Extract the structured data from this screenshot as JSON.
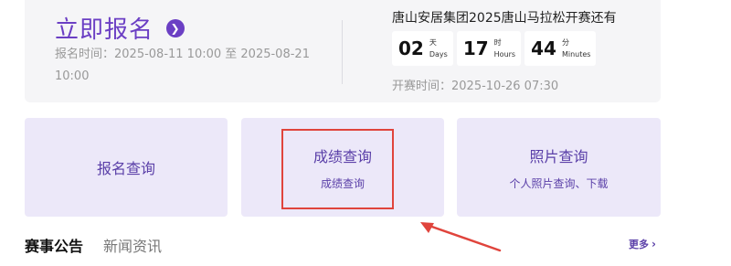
{
  "registration": {
    "title": "立即报名",
    "arrow_icon": "arrow-right-icon",
    "time_text": "报名时间：2025-08-11 10:00 至 2025-08-21 10:00"
  },
  "countdown": {
    "title": "唐山安居集团2025唐山马拉松开赛还有",
    "days": "02",
    "days_cn": "天",
    "days_en": "Days",
    "hours": "17",
    "hours_cn": "时",
    "hours_en": "Hours",
    "minutes": "44",
    "minutes_cn": "分",
    "minutes_en": "Minutes",
    "match_time": "开赛时间：2025-10-26 07:30"
  },
  "cards": [
    {
      "title": "报名查询",
      "subtitle": ""
    },
    {
      "title": "成绩查询",
      "subtitle": "成绩查询"
    },
    {
      "title": "照片查询",
      "subtitle": "个人照片查询、下载"
    }
  ],
  "tabs": {
    "active": "赛事公告",
    "inactive": "新闻资讯"
  },
  "more": {
    "label": "更多",
    "icon": "chevron-right-icon"
  },
  "colors": {
    "accent": "#6b3fc4",
    "card_bg": "#ece8f9",
    "highlight": "#e0443c"
  }
}
